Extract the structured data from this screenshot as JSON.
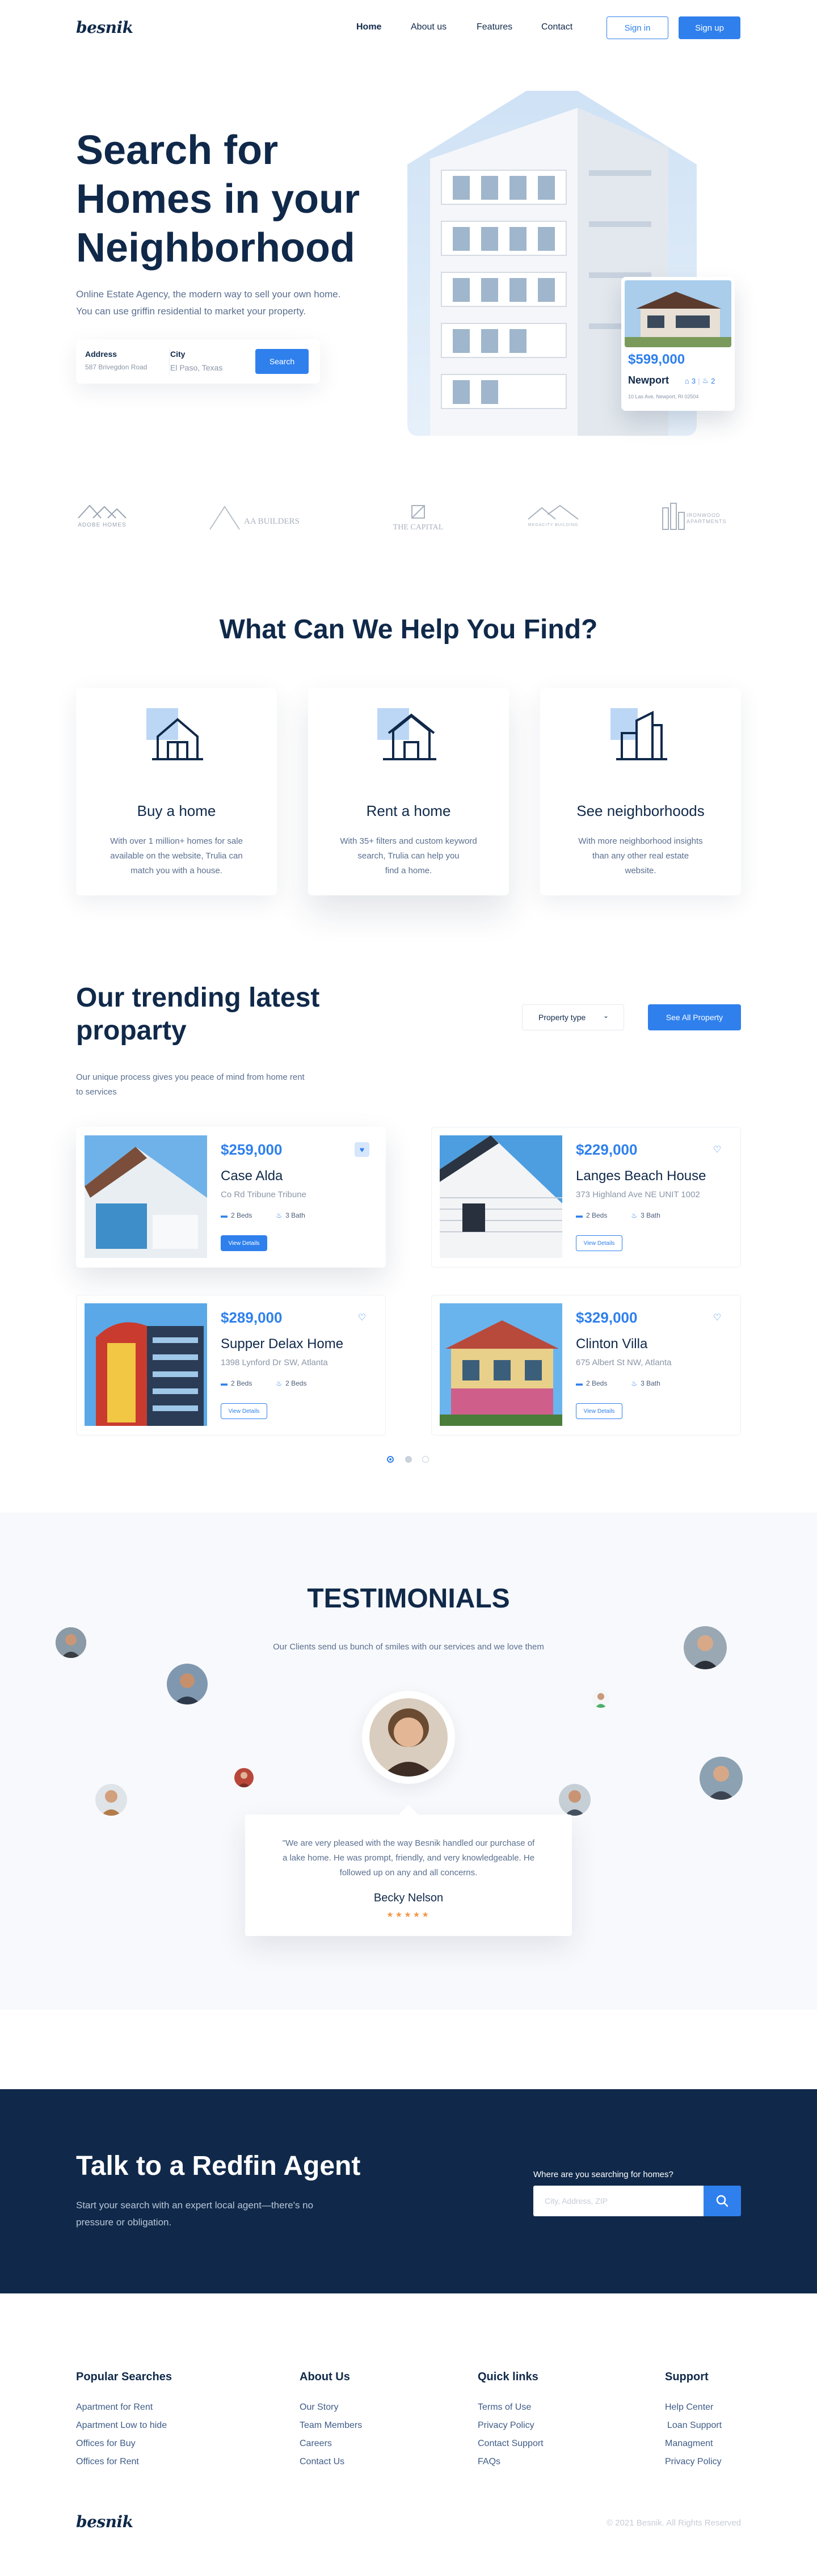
{
  "header": {
    "logo": "besnik",
    "nav": [
      "Home",
      "About us",
      "Features",
      "Contact"
    ],
    "sign_in": "Sign in",
    "sign_up": "Sign up"
  },
  "hero": {
    "title_line1": "Search for",
    "title_line2": "Homes in your",
    "title_line3": "Neighborhood",
    "subtitle_line1": "Online Estate Agency, the modern way to sell your own home.",
    "subtitle_line2": "You can use griffin residential to market your property.",
    "search": {
      "address_label": "Address",
      "address_value": "587 Brivegdon Road",
      "city_label": "City",
      "city_value": "El Paso, Texas",
      "button": "Search"
    },
    "listing": {
      "price": "$599,000",
      "name": "Newport",
      "beds": "3",
      "baths": "2",
      "address": "10 Las Ave, Newport, RI 02504"
    }
  },
  "partners": [
    "ADOBE HOMES",
    "AA BUILDERS",
    "THE CAPITAL",
    "MEGACITY BUILDING",
    "IRONWOOD APARTMENTS"
  ],
  "help": {
    "title": "What Can We Help You Find?",
    "cards": [
      {
        "title": "Buy a home",
        "l1": "With over 1 million+ homes for sale",
        "l2": "available on the website, Trulia can",
        "l3": "match you with a house."
      },
      {
        "title": "Rent a home",
        "l1": "With 35+ filters and custom keyword",
        "l2": "search, Trulia can help you",
        "l3": "find a home."
      },
      {
        "title": "See neighborhoods",
        "l1": "With more neighborhood insights",
        "l2": "than any other real estate",
        "l3": "website."
      }
    ]
  },
  "trending": {
    "title_line1": "Our trending latest",
    "title_line2": "proparty",
    "desc_line1": "Our unique process gives you peace of mind from home rent",
    "desc_line2": "to services",
    "filter": "Property type",
    "see_all": "See All Property",
    "beds_label": "2 Beds",
    "baths_label": "3 Bath",
    "view_details": "View Details",
    "properties": [
      {
        "price": "$259,000",
        "name": "Case Alda",
        "address": "Co Rd Tribune Tribune"
      },
      {
        "price": "$229,000",
        "name": "Langes Beach House",
        "address": "373 Highland Ave NE UNIT 1002"
      },
      {
        "price": "$289,000",
        "name": "Supper Delax Home",
        "address": "1398 Lynford Dr SW, Atlanta"
      },
      {
        "price": "$329,000",
        "name": "Clinton Villa",
        "address": "675 Albert St NW, Atlanta"
      }
    ],
    "beds_2": "2 Beds"
  },
  "testimonials": {
    "title": "TESTIMONIALS",
    "subtitle": "Our Clients send us bunch of smiles with our services and we love them",
    "quote_l1": "\"We are very pleased with the way Besnik handled our purchase of",
    "quote_l2": "a lake home. He was prompt, friendly, and very knowledgeable. He",
    "quote_l3": "followed up on any and all concerns.",
    "author": "Becky Nelson",
    "stars": "★★★★★"
  },
  "agent": {
    "title": "Talk to a Redfin Agent",
    "desc_l1": "Start your search with an expert local agent—there's no",
    "desc_l2": "pressure or obligation.",
    "search_label": "Where are you searching for homes?",
    "placeholder": "City, Address, ZIP"
  },
  "footer": {
    "col1": {
      "title": "Popular Searches",
      "links": [
        "Apartment for Rent",
        "Apartment Low to hide",
        "Offices for Buy",
        "Offices for Rent"
      ]
    },
    "col2": {
      "title": "About Us",
      "links": [
        "Our Story",
        "Team Members",
        "Careers",
        "Contact Us"
      ]
    },
    "col3": {
      "title": "Quick links",
      "links": [
        "Terms of Use",
        "Privacy Policy",
        "Contact Support",
        "FAQs"
      ]
    },
    "col4": {
      "title": "Support",
      "links": [
        "Help Center",
        "Loan Support",
        "Managment",
        "Privacy Policy"
      ]
    },
    "logo": "besnik",
    "copyright": "© 2021 Besnik. All Rights Reserved"
  },
  "colors": {
    "primary": "#2f80ed",
    "navy": "#10294a",
    "star": "#f2994a"
  }
}
